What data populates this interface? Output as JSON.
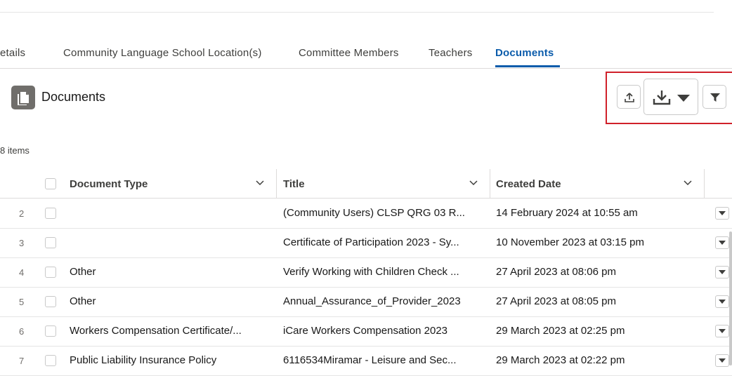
{
  "tabs": [
    {
      "label": "etails",
      "active": false
    },
    {
      "label": "Community Language School Location(s)",
      "active": false
    },
    {
      "label": "Committee Members",
      "active": false
    },
    {
      "label": "Teachers",
      "active": false
    },
    {
      "label": "Documents",
      "active": true
    }
  ],
  "documents": {
    "title": "Documents",
    "item_count": "8 items",
    "icon": "document-icon",
    "toolbar": [
      {
        "name": "upload-button",
        "icon": "upload-icon"
      },
      {
        "name": "download-menu-button",
        "icon": "download-icon"
      },
      {
        "name": "filter-button",
        "icon": "filter-icon"
      }
    ]
  },
  "table": {
    "columns": [
      "Document Type",
      "Title",
      "Created Date"
    ],
    "rows": [
      {
        "num": "2",
        "type": "",
        "title": "(Community Users) CLSP QRG 03 R...",
        "date": "14 February 2024 at 10:55 am"
      },
      {
        "num": "3",
        "type": "",
        "title": "Certificate of Participation 2023 - Sy...",
        "date": "10 November 2023 at 03:15 pm"
      },
      {
        "num": "4",
        "type": "Other",
        "title": "Verify Working with Children Check ...",
        "date": "27 April 2023 at 08:06 pm"
      },
      {
        "num": "5",
        "type": "Other",
        "title": "Annual_Assurance_of_Provider_2023",
        "date": "27 April 2023 at 08:05 pm"
      },
      {
        "num": "6",
        "type": "Workers Compensation Certificate/...",
        "title": "iCare Workers Compensation 2023",
        "date": "29 March 2023 at 02:25 pm"
      },
      {
        "num": "7",
        "type": "Public Liability Insurance Policy",
        "title": "6116534Miramar - Leisure and Sec...",
        "date": "29 March 2023 at 02:22 pm"
      }
    ]
  },
  "colors": {
    "accent": "#0b5cab",
    "highlight": "#d0202a",
    "icon_bg": "#706e6b"
  }
}
